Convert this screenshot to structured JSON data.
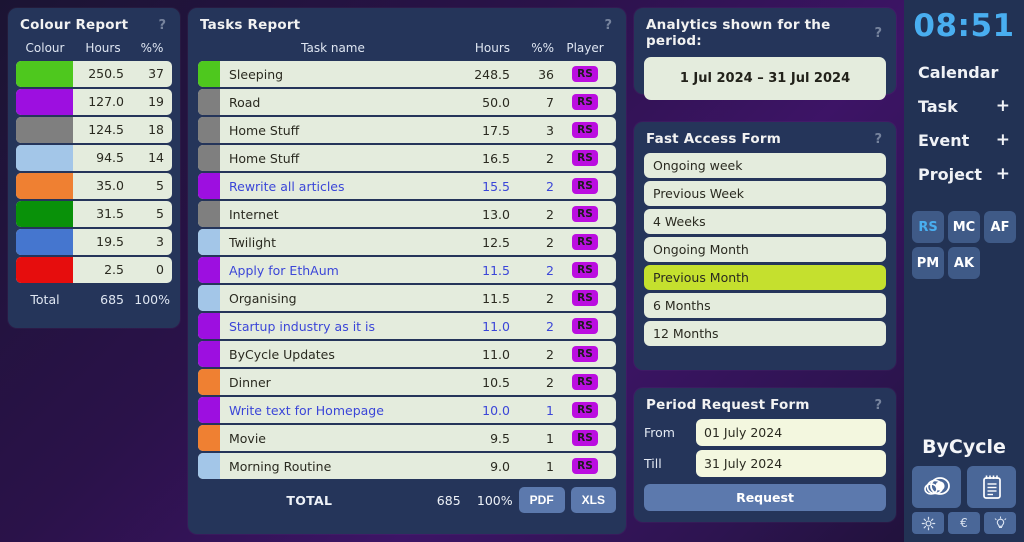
{
  "colour_report": {
    "title": "Colour Report",
    "help": "?",
    "columns": [
      "Colour",
      "Hours",
      "%%"
    ],
    "rows": [
      {
        "colour": "#4ec81e",
        "hours": "250.5",
        "pct": "37"
      },
      {
        "colour": "#9d0fe0",
        "hours": "127.0",
        "pct": "19"
      },
      {
        "colour": "#7f7f7f",
        "hours": "124.5",
        "pct": "18"
      },
      {
        "colour": "#a3c6e8",
        "hours": "94.5",
        "pct": "14"
      },
      {
        "colour": "#ef8032",
        "hours": "35.0",
        "pct": "5"
      },
      {
        "colour": "#099109",
        "hours": "31.5",
        "pct": "5"
      },
      {
        "colour": "#4576cf",
        "hours": "19.5",
        "pct": "3"
      },
      {
        "colour": "#e60d0d",
        "hours": "2.5",
        "pct": "0"
      }
    ],
    "total": {
      "label": "Total",
      "hours": "685",
      "pct": "100%"
    }
  },
  "tasks_report": {
    "title": "Tasks Report",
    "help": "?",
    "columns": [
      "Task name",
      "Hours",
      "%%",
      "Player"
    ],
    "rows": [
      {
        "colour": "#4ec81e",
        "name": "Sleeping",
        "hours": "248.5",
        "pct": "36",
        "player": "RS",
        "link": false
      },
      {
        "colour": "#7f7f7f",
        "name": "Road",
        "hours": "50.0",
        "pct": "7",
        "player": "RS",
        "link": false
      },
      {
        "colour": "#7f7f7f",
        "name": "Home Stuff",
        "hours": "17.5",
        "pct": "3",
        "player": "RS",
        "link": false
      },
      {
        "colour": "#7f7f7f",
        "name": "Home Stuff",
        "hours": "16.5",
        "pct": "2",
        "player": "RS",
        "link": false
      },
      {
        "colour": "#9d0fe0",
        "name": "Rewrite all articles",
        "hours": "15.5",
        "pct": "2",
        "player": "RS",
        "link": true
      },
      {
        "colour": "#7f7f7f",
        "name": "Internet",
        "hours": "13.0",
        "pct": "2",
        "player": "RS",
        "link": false
      },
      {
        "colour": "#a3c6e8",
        "name": "Twilight",
        "hours": "12.5",
        "pct": "2",
        "player": "RS",
        "link": false
      },
      {
        "colour": "#9d0fe0",
        "name": "Apply for EthAum",
        "hours": "11.5",
        "pct": "2",
        "player": "RS",
        "link": true
      },
      {
        "colour": "#a3c6e8",
        "name": "Organising",
        "hours": "11.5",
        "pct": "2",
        "player": "RS",
        "link": false
      },
      {
        "colour": "#9d0fe0",
        "name": "Startup industry as it is",
        "hours": "11.0",
        "pct": "2",
        "player": "RS",
        "link": true
      },
      {
        "colour": "#9d0fe0",
        "name": "ByCycle Updates",
        "hours": "11.0",
        "pct": "2",
        "player": "RS",
        "link": false
      },
      {
        "colour": "#ef8032",
        "name": "Dinner",
        "hours": "10.5",
        "pct": "2",
        "player": "RS",
        "link": false
      },
      {
        "colour": "#9d0fe0",
        "name": "Write text for Homepage",
        "hours": "10.0",
        "pct": "1",
        "player": "RS",
        "link": true
      },
      {
        "colour": "#ef8032",
        "name": "Movie",
        "hours": "9.5",
        "pct": "1",
        "player": "RS",
        "link": false
      },
      {
        "colour": "#a3c6e8",
        "name": "Morning Routine",
        "hours": "9.0",
        "pct": "1",
        "player": "RS",
        "link": false
      }
    ],
    "total": {
      "label": "TOTAL",
      "hours": "685",
      "pct": "100%"
    },
    "export_pdf": "PDF",
    "export_xls": "XLS"
  },
  "analytics_period": {
    "title": "Analytics shown for the period:",
    "help": "?",
    "value": "1 Jul 2024 – 31 Jul 2024"
  },
  "fast_access": {
    "title": "Fast Access Form",
    "help": "?",
    "items": [
      {
        "label": "Ongoing week",
        "selected": false
      },
      {
        "label": "Previous Week",
        "selected": false
      },
      {
        "label": "4 Weeks",
        "selected": false
      },
      {
        "label": "Ongoing Month",
        "selected": false
      },
      {
        "label": "Previous Month",
        "selected": true
      },
      {
        "label": "6 Months",
        "selected": false
      },
      {
        "label": "12 Months",
        "selected": false
      }
    ]
  },
  "period_request": {
    "title": "Period Request Form",
    "help": "?",
    "from_label": "From",
    "from_value": "01 July 2024",
    "till_label": "Till",
    "till_value": "31 July 2024",
    "submit_label": "Request"
  },
  "sidebar": {
    "clock": "08:51",
    "nav": [
      {
        "label": "Calendar",
        "plus": ""
      },
      {
        "label": "Task",
        "plus": "+"
      },
      {
        "label": "Event",
        "plus": "+"
      },
      {
        "label": "Project",
        "plus": "+"
      }
    ],
    "avatars": [
      {
        "initials": "RS",
        "active": true
      },
      {
        "initials": "MC",
        "active": false
      },
      {
        "initials": "AF",
        "active": false
      },
      {
        "initials": "PM",
        "active": false
      },
      {
        "initials": "AK",
        "active": false
      }
    ],
    "brand": "ByCycle",
    "app_tiles": [
      "rings-icon",
      "notepad-icon"
    ],
    "mini_tiles": [
      {
        "name": "gear-icon",
        "glyph": ""
      },
      {
        "name": "euro-icon",
        "glyph": "€"
      },
      {
        "name": "lightbulb-icon",
        "glyph": ""
      }
    ]
  },
  "theme": {
    "panel_bg": "#25355a",
    "sidebar_bg": "#223254",
    "field_bg": "#e4ecdd",
    "accent_select": "#c5e02e",
    "accent_clock": "#49aef0",
    "badge_bg": "#bb0ee0",
    "button_bg": "#5c79ad",
    "link_color": "#3b46d8"
  }
}
